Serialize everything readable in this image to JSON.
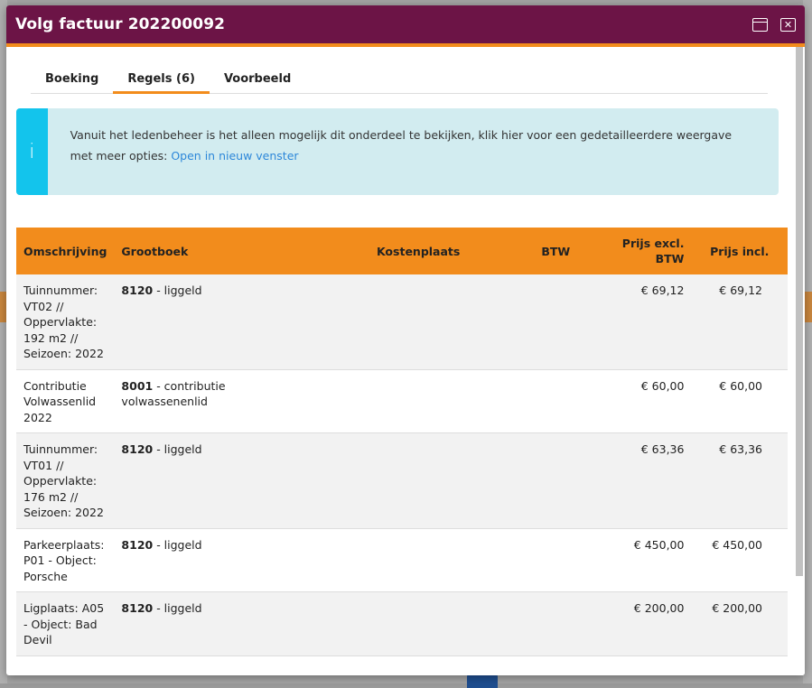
{
  "modal": {
    "title": "Volg factuur 202200092",
    "maximize_icon": "maximize-icon",
    "close_icon": "close-icon"
  },
  "tabs": [
    {
      "label": "Boeking",
      "active": false
    },
    {
      "label": "Regels (6)",
      "active": true
    },
    {
      "label": "Voorbeeld",
      "active": false
    }
  ],
  "alert": {
    "icon": "info-icon",
    "icon_glyph": "i",
    "text": "Vanuit het ledenbeheer is het alleen mogelijk dit onderdeel te bekijken, klik hier voor een gedetailleerdere weergave met meer opties: ",
    "link": "Open in nieuw venster"
  },
  "table": {
    "headers": {
      "omschrijving": "Omschrijving",
      "grootboek": "Grootboek",
      "kostenplaats": "Kostenplaats",
      "btw": "BTW",
      "prijs_excl": "Prijs excl. BTW",
      "prijs_incl": "Prijs incl."
    },
    "rows": [
      {
        "omschrijving": "Tuinnummer: VT02 // Oppervlakte: 192 m2 // Seizoen: 2022",
        "code": "8120",
        "name": " - liggeld",
        "kostenplaats": "",
        "btw": "",
        "excl": "€ 69,12",
        "incl": "€ 69,12"
      },
      {
        "omschrijving": "Contributie Volwassenlid 2022",
        "code": "8001",
        "name": " - contributie volwassenenlid",
        "kostenplaats": "",
        "btw": "",
        "excl": "€ 60,00",
        "incl": "€ 60,00"
      },
      {
        "omschrijving": "Tuinnummer: VT01 // Oppervlakte: 176 m2 // Seizoen: 2022",
        "code": "8120",
        "name": " - liggeld",
        "kostenplaats": "",
        "btw": "",
        "excl": "€ 63,36",
        "incl": "€ 63,36"
      },
      {
        "omschrijving": "Parkeerplaats: P01 - Object: Porsche",
        "code": "8120",
        "name": " - liggeld",
        "kostenplaats": "",
        "btw": "",
        "excl": "€ 450,00",
        "incl": "€ 450,00"
      },
      {
        "omschrijving": "Ligplaats: A05 - Object: Bad Devil",
        "code": "8120",
        "name": " - liggeld",
        "kostenplaats": "",
        "btw": "",
        "excl": "€ 200,00",
        "incl": "€ 200,00"
      }
    ]
  },
  "colors": {
    "header_bg": "#6c1446",
    "accent": "#f28c1c",
    "alert_bg": "#d2ecf0",
    "alert_bar": "#13c4ec",
    "link": "#2d87d9"
  }
}
